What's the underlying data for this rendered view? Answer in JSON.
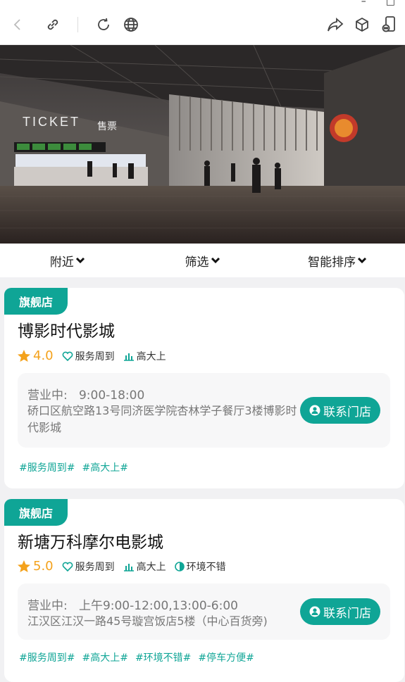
{
  "window": {
    "minimize": "–",
    "maximize": "□"
  },
  "toolbar": {
    "icons": [
      "back-icon",
      "link-icon",
      "refresh-icon",
      "globe-icon",
      "share-icon",
      "cube-icon",
      "phone-icon"
    ]
  },
  "filters": [
    {
      "label": "附近"
    },
    {
      "label": "筛选"
    },
    {
      "label": "智能排序"
    }
  ],
  "hero": {
    "ticket": "TICKET",
    "ticket_cn": "售票"
  },
  "cards": [
    {
      "badge": "旗舰店",
      "name": "博影时代影城",
      "rating": "4.0",
      "tags": [
        "服务周到",
        "高大上"
      ],
      "hours_label": "营业中:",
      "hours": "9:00-18:00",
      "address": "硚口区航空路13号同济医学院杏林学子餐厅3楼博影时代影城",
      "contact": "联系门店",
      "hashtags": [
        "#服务周到#",
        "#高大上#"
      ]
    },
    {
      "badge": "旗舰店",
      "name": "新塘万科摩尔电影城",
      "rating": "5.0",
      "tags": [
        "服务周到",
        "高大上",
        "环境不错"
      ],
      "hours_label": "营业中:",
      "hours": "上午9:00-12:00,13:00-6:00",
      "address": "江汉区江汉一路45号璇宫饭店5楼（中心百货旁)",
      "contact": "联系门店",
      "hashtags": [
        "#服务周到#",
        "#高大上#",
        "#环境不错#",
        "#停车方便#"
      ]
    }
  ],
  "colors": {
    "accent": "#0fa596",
    "star": "#f4a21c"
  }
}
